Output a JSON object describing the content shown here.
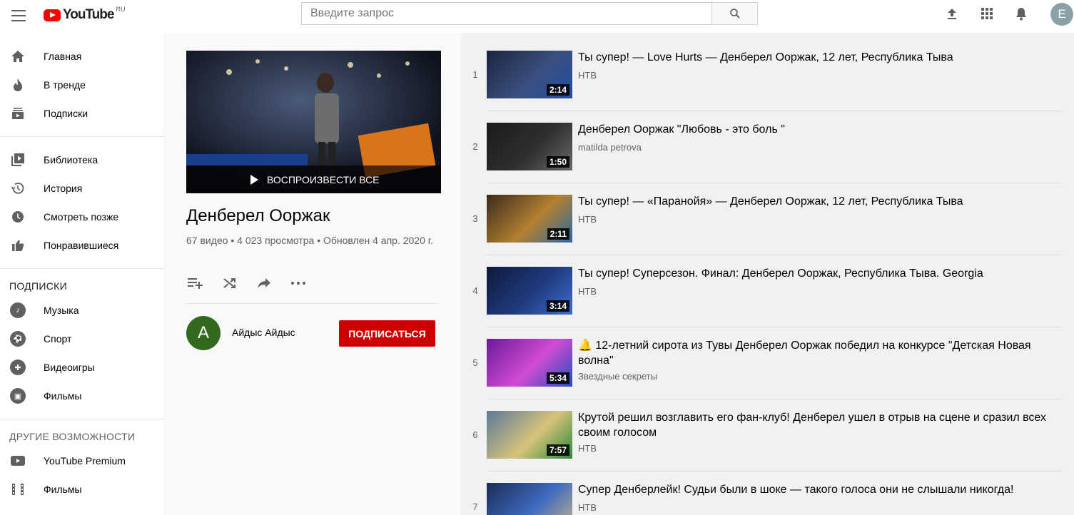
{
  "topbar": {
    "logo_text": "YouTube",
    "logo_region": "RU",
    "search_placeholder": "Введите запрос",
    "avatar_letter": "E"
  },
  "sidebar": {
    "main": [
      {
        "label": "Главная",
        "icon": "home-icon"
      },
      {
        "label": "В тренде",
        "icon": "flame-icon"
      },
      {
        "label": "Подписки",
        "icon": "subscriptions-icon"
      }
    ],
    "library": [
      {
        "label": "Библиотека",
        "icon": "library-icon"
      },
      {
        "label": "История",
        "icon": "history-icon"
      },
      {
        "label": "Смотреть позже",
        "icon": "clock-icon"
      },
      {
        "label": "Понравившиеся",
        "icon": "thumbs-up-icon"
      }
    ],
    "subscriptions_title": "ПОДПИСКИ",
    "subscriptions": [
      {
        "label": "Музыка",
        "icon": "music-icon"
      },
      {
        "label": "Спорт",
        "icon": "sport-icon"
      },
      {
        "label": "Видеоигры",
        "icon": "gaming-icon"
      },
      {
        "label": "Фильмы",
        "icon": "film-icon"
      }
    ],
    "more_title": "ДРУГИЕ ВОЗМОЖНОСТИ",
    "more": [
      {
        "label": "YouTube Premium",
        "icon": "youtube-icon"
      },
      {
        "label": "Фильмы",
        "icon": "film-strip-icon"
      }
    ]
  },
  "playlist": {
    "play_all_label": "ВОСПРОИЗВЕСТИ ВСЕ",
    "title": "Денберел Ооржак",
    "stats": "67 видео • 4 023 просмотра • Обновлен 4 апр. 2020 г.",
    "owner_initial": "A",
    "owner_name": "Айдыс Айдыс",
    "subscribe_label": "ПОДПИСАТЬСЯ",
    "accent_color": "#cc0000"
  },
  "videos": [
    {
      "index": "1",
      "title": "Ты супер! — Love Hurts — Денберел Ооржак, 12 лет, Республика Тыва",
      "channel": "НТВ",
      "duration": "2:14"
    },
    {
      "index": "2",
      "title": "Денберел Ооржак \"Любовь - это боль \"",
      "channel": "matilda petrova",
      "duration": "1:50"
    },
    {
      "index": "3",
      "title": "Ты супер! — «Паранойя» — Денберел Ооржак, 12 лет, Республика Тыва",
      "channel": "НТВ",
      "duration": "2:11"
    },
    {
      "index": "4",
      "title": "Ты супер! Суперсезон. Финал: Денберел Ооржак, Республика Тыва. Georgia",
      "channel": "НТВ",
      "duration": "3:14"
    },
    {
      "index": "5",
      "title": "🔔 12-летний сирота из Тувы Денберел Ооржак победил на конкурсе \"Детская Новая волна\"",
      "channel": "Звездные секреты",
      "duration": "5:34"
    },
    {
      "index": "6",
      "title": "Крутой решил возглавить его фан-клуб! Денберел ушел в отрыв на сцене и сразил всех своим голосом",
      "channel": "НТВ",
      "duration": "7:57"
    },
    {
      "index": "7",
      "title": "Супер Денберлейк! Судьи были в шоке — такого голоса они не слышали никогда!",
      "channel": "НТВ",
      "duration": ""
    }
  ]
}
